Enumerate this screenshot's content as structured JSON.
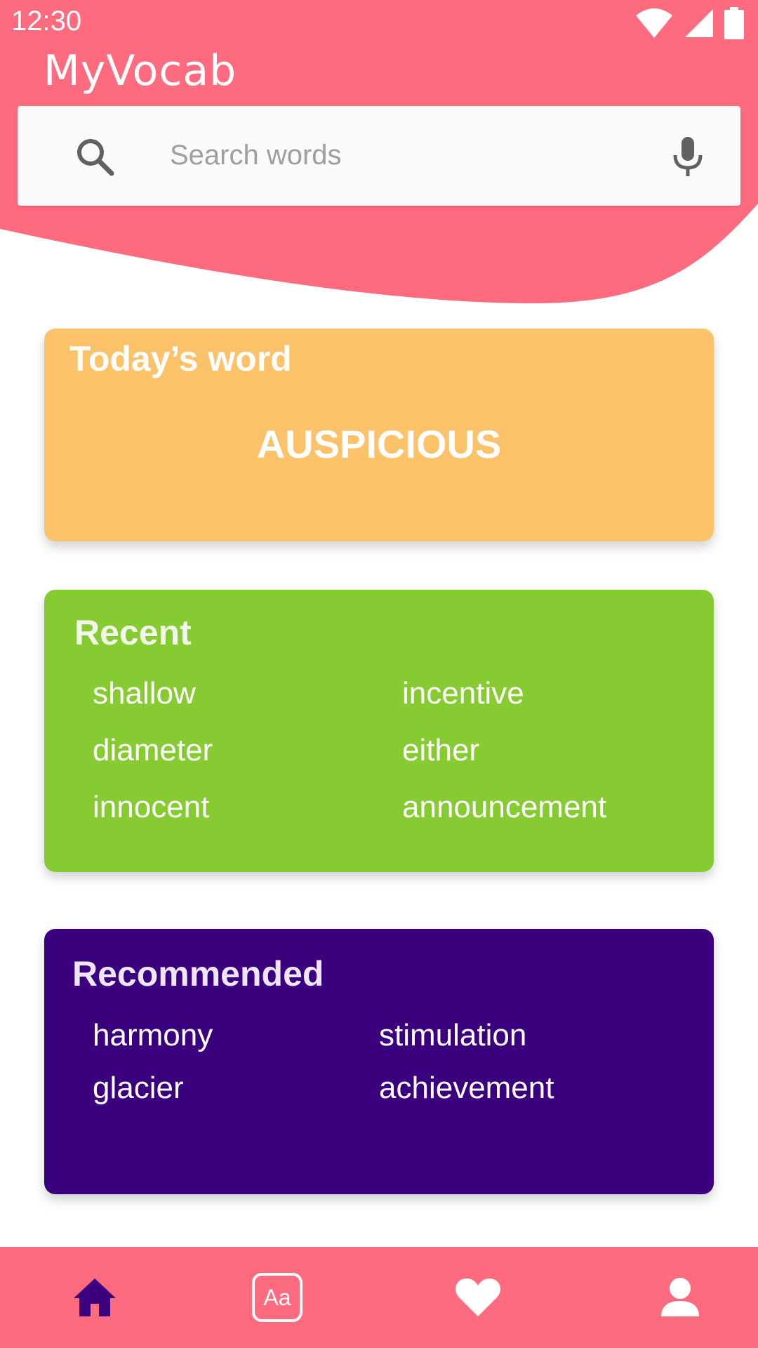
{
  "colors": {
    "header": "#ff6b7e",
    "search_bg": "#fafafa",
    "today_card": "#fcc26a",
    "recent_card": "#86cb32",
    "recommended_card": "#3a007e",
    "bottom_nav": "#ff6b7e",
    "nav_active": "#3a007e"
  },
  "status_bar": {
    "time": "12:30",
    "icons": [
      "wifi-icon",
      "cell-signal-icon",
      "battery-icon"
    ]
  },
  "app": {
    "title": "MyVocab"
  },
  "search": {
    "placeholder": "Search words",
    "value": "",
    "icon": "search-icon",
    "voice_icon": "mic-icon"
  },
  "today": {
    "title": "Today’s word",
    "word": "AUSPICIOUS"
  },
  "recent": {
    "title": "Recent",
    "words": [
      "shallow",
      "incentive",
      "diameter",
      "either",
      "innocent",
      "announcement"
    ]
  },
  "recommended": {
    "title": "Recommended",
    "words": [
      "harmony",
      "stimulation",
      "glacier",
      "achievement"
    ]
  },
  "bottom_nav": {
    "items": [
      {
        "icon": "home-icon",
        "active": true
      },
      {
        "icon": "dictionary-icon",
        "active": false
      },
      {
        "icon": "heart-icon",
        "active": false
      },
      {
        "icon": "profile-icon",
        "active": false
      }
    ],
    "dictionary_icon_text": "Aa"
  }
}
